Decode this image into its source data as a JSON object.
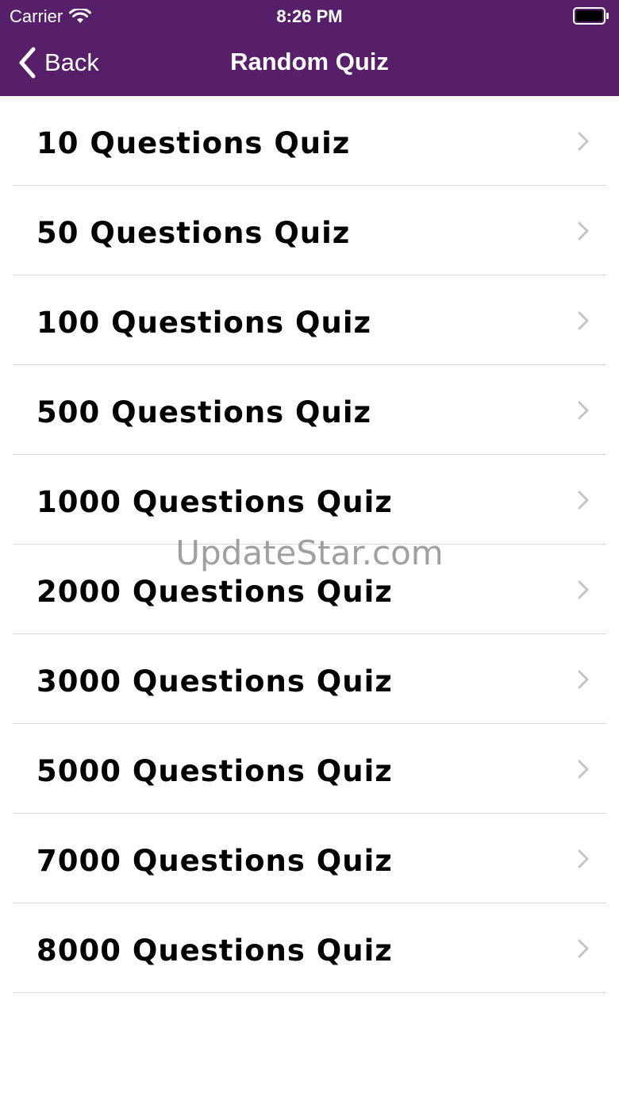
{
  "status_bar": {
    "carrier": "Carrier",
    "time": "8:26 PM"
  },
  "nav": {
    "back_label": "Back",
    "title": "Random Quiz",
    "background_color": "#571f69"
  },
  "list": {
    "items": [
      {
        "label": "10 Questions Quiz"
      },
      {
        "label": "50 Questions Quiz"
      },
      {
        "label": "100 Questions Quiz"
      },
      {
        "label": "500 Questions Quiz"
      },
      {
        "label": "1000 Questions Quiz"
      },
      {
        "label": "2000 Questions Quiz"
      },
      {
        "label": "3000 Questions Quiz"
      },
      {
        "label": "5000 Questions Quiz"
      },
      {
        "label": "7000 Questions Quiz"
      },
      {
        "label": "8000 Questions Quiz"
      }
    ]
  },
  "watermark": "UpdateStar.com"
}
